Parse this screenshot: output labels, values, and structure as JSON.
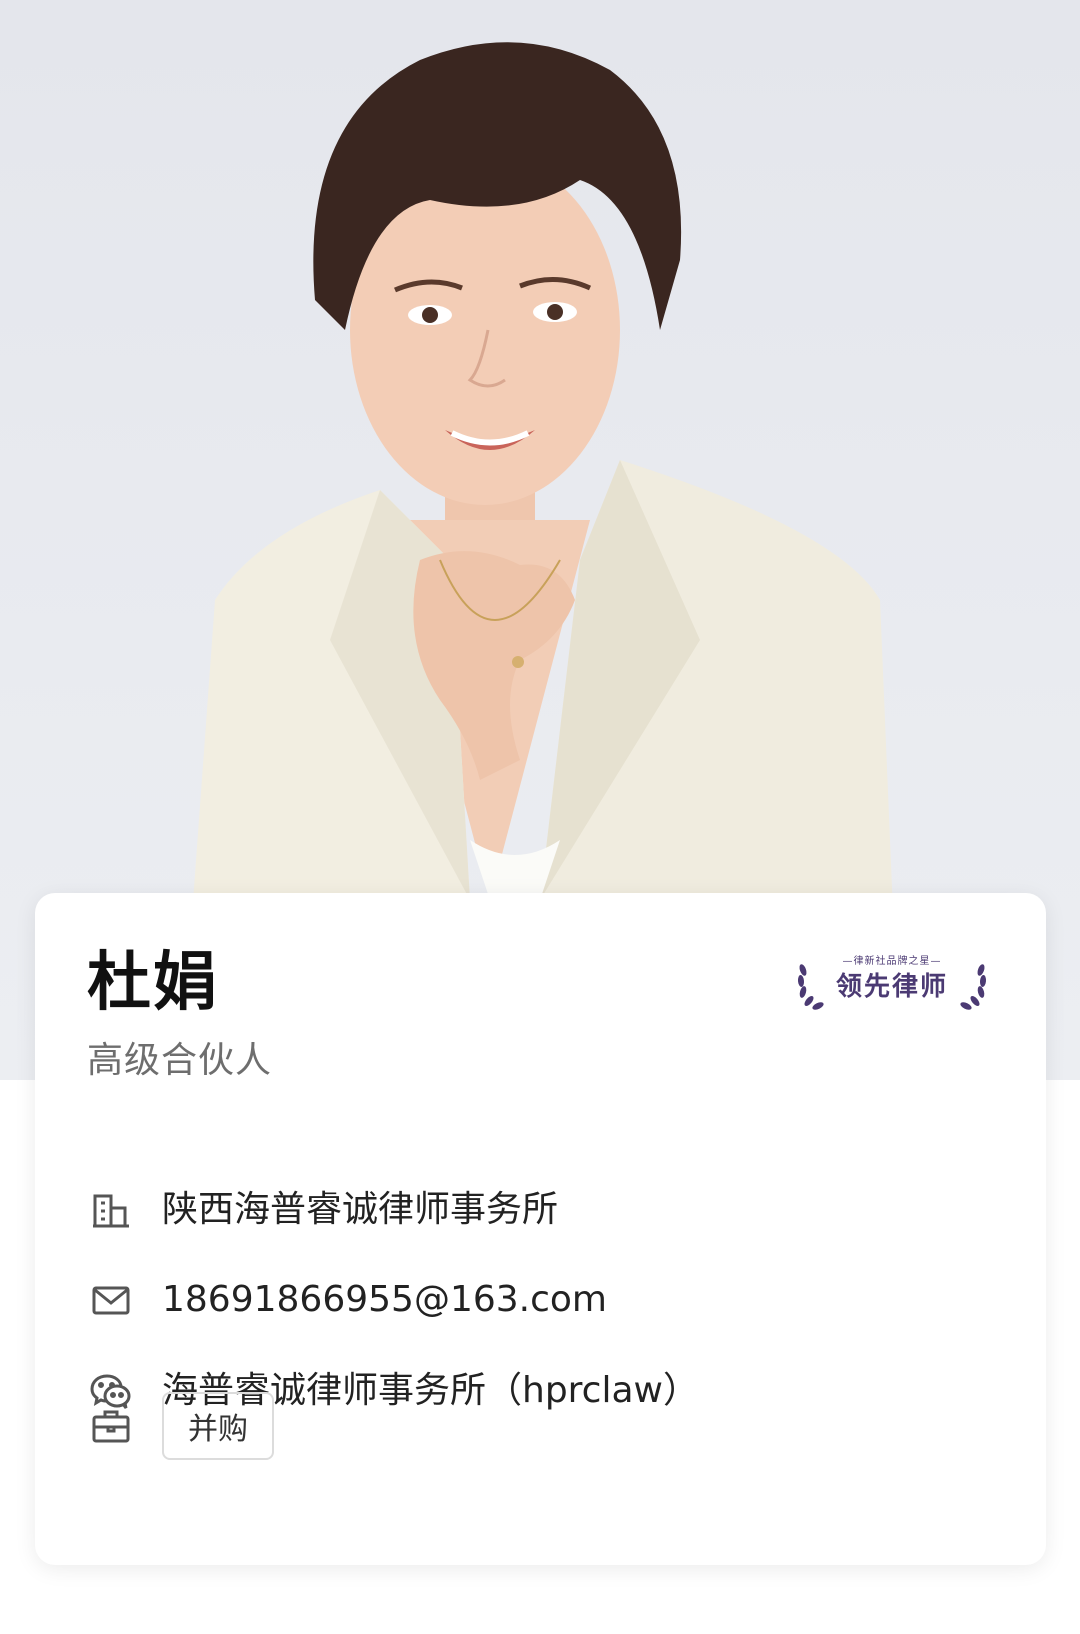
{
  "profile": {
    "name": "杜娟",
    "title": "高级合伙人",
    "badge": {
      "subtitle": "—律新社品牌之星—",
      "label": "领先律师"
    },
    "company": "陕西海普睿诚律师事务所",
    "email": "18691866955@163.com",
    "wechat": "海普睿诚律师事务所（hprclaw）",
    "tags": [
      "并购"
    ]
  },
  "icons": {
    "company": "building-icon",
    "email": "mail-icon",
    "wechat": "wechat-icon",
    "tags": "briefcase-icon"
  },
  "colors": {
    "badge": "#4b3a73",
    "name": "#111111",
    "title": "#6e6e6e",
    "body_text": "#222222",
    "icon": "#555555",
    "hero_background": "#e6e8ed",
    "blazer": "#f1ede0"
  }
}
